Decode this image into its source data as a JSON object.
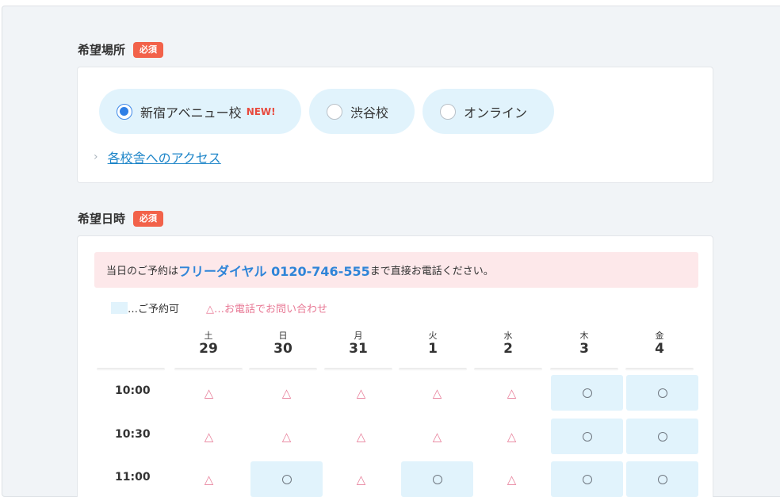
{
  "location": {
    "label": "希望場所",
    "required": "必須",
    "options": [
      {
        "label": "新宿アベニュー校",
        "tag": "NEW!",
        "checked": true
      },
      {
        "label": "渋谷校",
        "tag": "",
        "checked": false
      },
      {
        "label": "オンライン",
        "tag": "",
        "checked": false
      }
    ],
    "access_link": "各校舎へのアクセス"
  },
  "datetime": {
    "label": "希望日時",
    "required": "必須",
    "notice": {
      "prefix": "当日のご予約は",
      "phone": "フリーダイヤル 0120-746-555",
      "suffix": "まで直接お電話ください。"
    },
    "legend": {
      "available": "…ご予約可",
      "phone_only": "△…お電話でお問い合わせ"
    },
    "days": [
      {
        "weekday": "土",
        "date": "29"
      },
      {
        "weekday": "日",
        "date": "30"
      },
      {
        "weekday": "月",
        "date": "31"
      },
      {
        "weekday": "火",
        "date": "1"
      },
      {
        "weekday": "水",
        "date": "2"
      },
      {
        "weekday": "木",
        "date": "3"
      },
      {
        "weekday": "金",
        "date": "4"
      }
    ],
    "slots": [
      {
        "time": "10:00",
        "status": [
          "tri",
          "tri",
          "tri",
          "tri",
          "tri",
          "ok",
          "ok"
        ]
      },
      {
        "time": "10:30",
        "status": [
          "tri",
          "tri",
          "tri",
          "tri",
          "tri",
          "ok",
          "ok"
        ]
      },
      {
        "time": "11:00",
        "status": [
          "tri",
          "ok",
          "tri",
          "ok",
          "tri",
          "ok",
          "ok"
        ]
      }
    ],
    "marks": {
      "tri": "△"
    }
  }
}
